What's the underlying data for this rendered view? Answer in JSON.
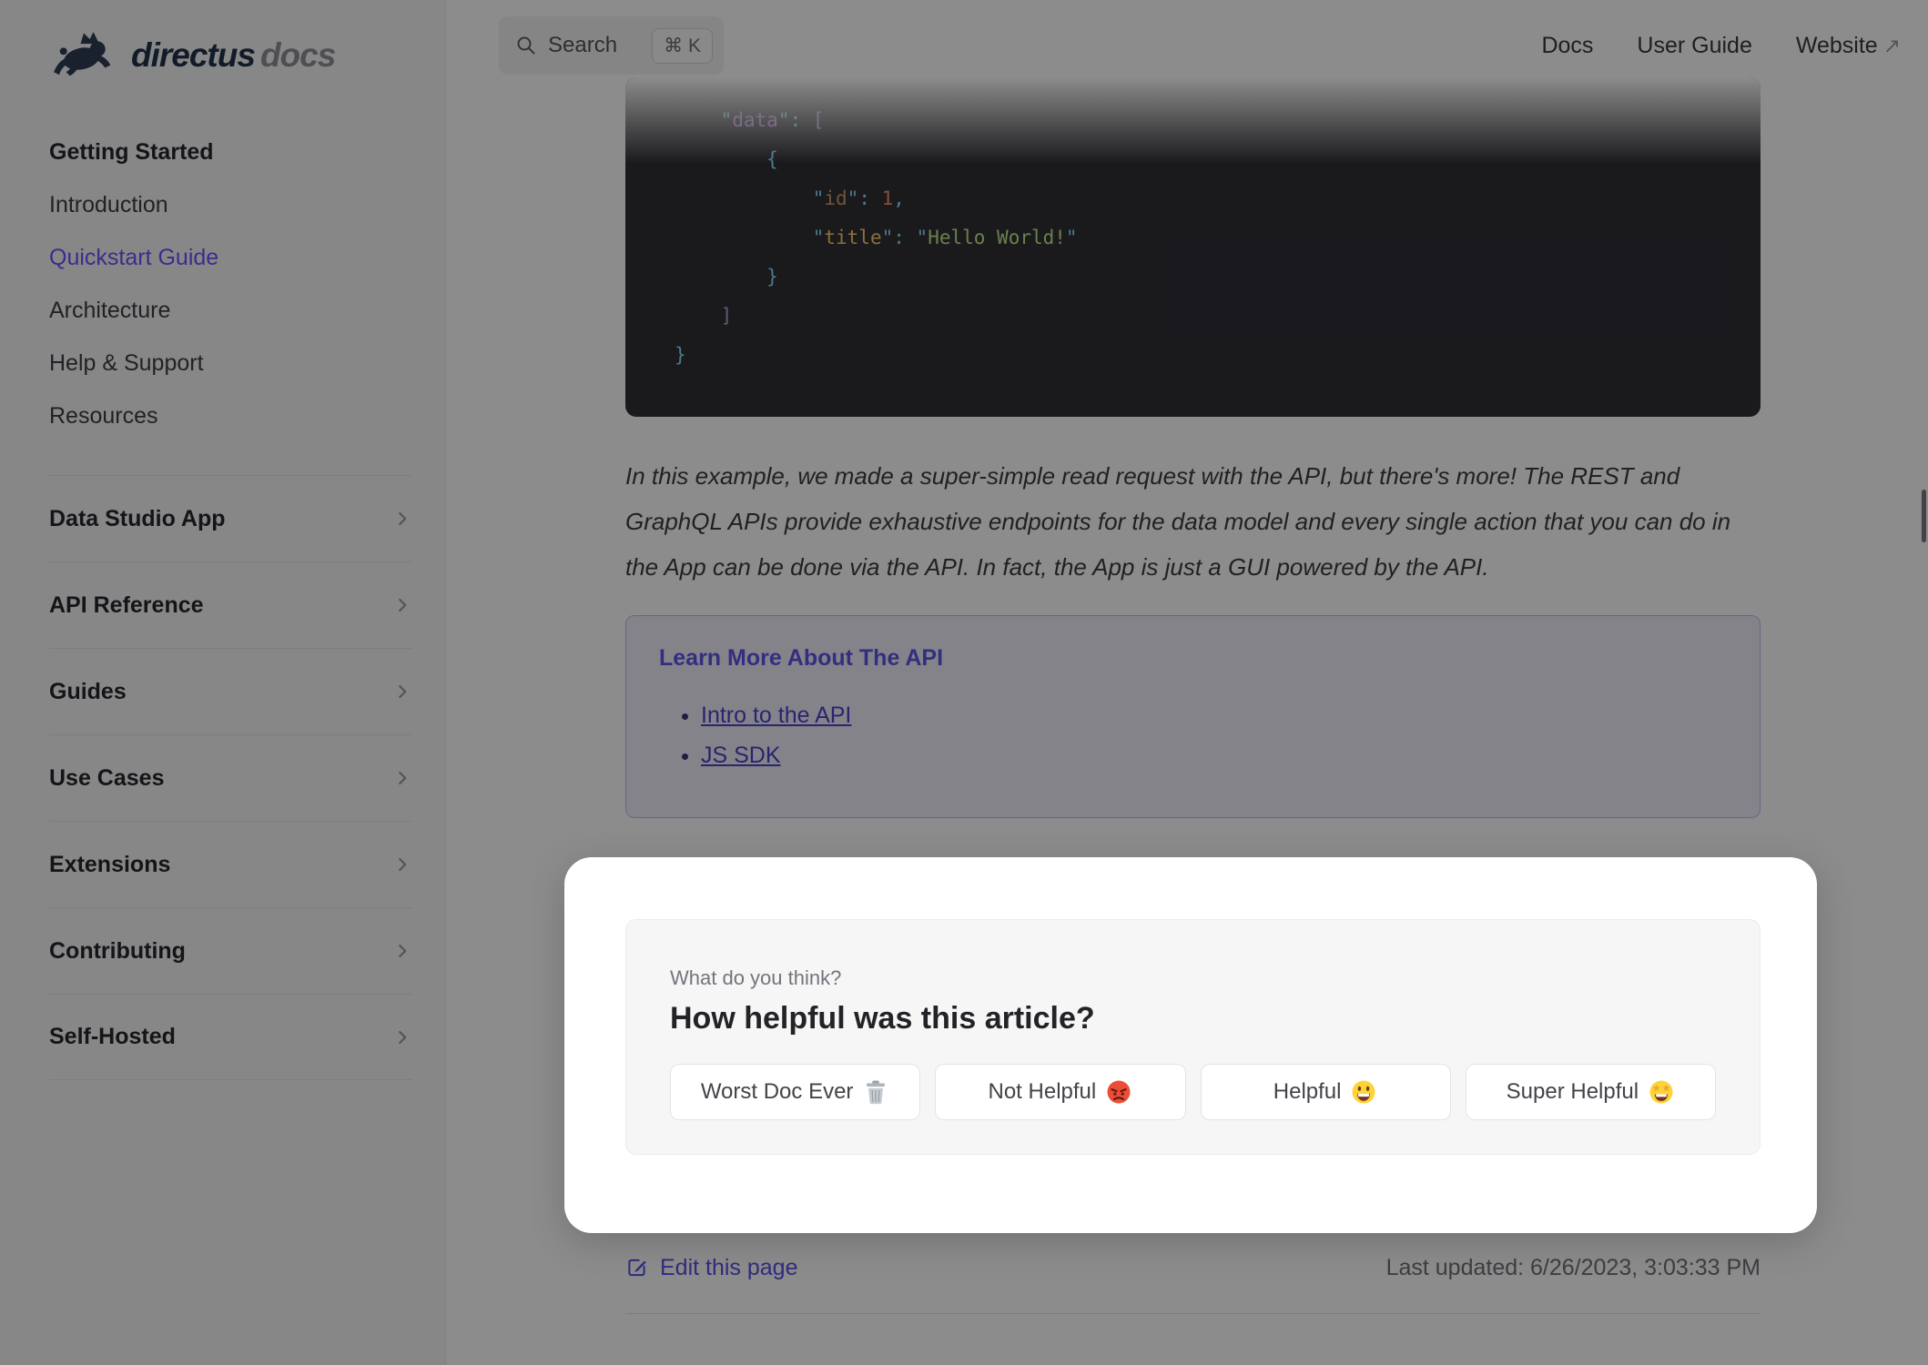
{
  "brand": {
    "name": "directus",
    "suffix": "docs",
    "logo_color": "#2e3d55"
  },
  "topnav": {
    "search_label": "Search",
    "search_shortcut": "⌘ K",
    "links": [
      {
        "label": "Docs"
      },
      {
        "label": "User Guide"
      },
      {
        "label": "Website",
        "external_arrow": "↗"
      }
    ]
  },
  "sidebar": {
    "section_title": "Getting Started",
    "items": [
      {
        "label": "Introduction",
        "active": false
      },
      {
        "label": "Quickstart Guide",
        "active": true
      },
      {
        "label": "Architecture",
        "active": false
      },
      {
        "label": "Help & Support",
        "active": false
      },
      {
        "label": "Resources",
        "active": false
      }
    ],
    "groups": [
      {
        "label": "Data Studio App"
      },
      {
        "label": "API Reference"
      },
      {
        "label": "Guides"
      },
      {
        "label": "Use Cases"
      },
      {
        "label": "Extensions"
      },
      {
        "label": "Contributing"
      },
      {
        "label": "Self-Hosted"
      }
    ]
  },
  "code": {
    "palette": {
      "fg": "#a6accd",
      "punct": "#89ddff",
      "bracket": "#a6accd",
      "key_purple": "#c792ea",
      "key_orange": "#d19a66",
      "key_yellow": "#ffcb6b",
      "num": "#f78c6c",
      "str": "#c3e88d"
    },
    "lines": [
      [
        {
          "t": "    ",
          "c": "fg"
        },
        {
          "t": "\"",
          "c": "punct"
        },
        {
          "t": "data",
          "c": "key_purple"
        },
        {
          "t": "\"",
          "c": "punct"
        },
        {
          "t": ": ",
          "c": "punct"
        },
        {
          "t": "[",
          "c": "bracket"
        }
      ],
      [
        {
          "t": "        ",
          "c": "fg"
        },
        {
          "t": "{",
          "c": "punct"
        }
      ],
      [
        {
          "t": "            ",
          "c": "fg"
        },
        {
          "t": "\"",
          "c": "punct"
        },
        {
          "t": "id",
          "c": "key_orange"
        },
        {
          "t": "\"",
          "c": "punct"
        },
        {
          "t": ": ",
          "c": "punct"
        },
        {
          "t": "1",
          "c": "num"
        },
        {
          "t": ",",
          "c": "punct"
        }
      ],
      [
        {
          "t": "            ",
          "c": "fg"
        },
        {
          "t": "\"",
          "c": "punct"
        },
        {
          "t": "title",
          "c": "key_yellow"
        },
        {
          "t": "\"",
          "c": "punct"
        },
        {
          "t": ": ",
          "c": "punct"
        },
        {
          "t": "\"",
          "c": "punct"
        },
        {
          "t": "Hello World!",
          "c": "str"
        },
        {
          "t": "\"",
          "c": "punct"
        }
      ],
      [
        {
          "t": "        ",
          "c": "fg"
        },
        {
          "t": "}",
          "c": "punct"
        }
      ],
      [
        {
          "t": "    ",
          "c": "fg"
        },
        {
          "t": "]",
          "c": "bracket"
        }
      ],
      [
        {
          "t": "}",
          "c": "punct"
        }
      ]
    ]
  },
  "content": {
    "paragraph": "In this example, we made a super-simple read request with the API, but there's more! The REST and GraphQL APIs provide exhaustive endpoints for the data model and every single action that you can do in the App can be done via the API. In fact, the App is just a GUI powered by the API."
  },
  "learn_more": {
    "title": "Learn More About The API",
    "links": [
      "Intro to the API",
      "JS SDK"
    ]
  },
  "feedback": {
    "kicker": "What do you think?",
    "question": "How helpful was this article?",
    "options": [
      {
        "label": "Worst Doc Ever",
        "emoji": "wastebasket"
      },
      {
        "label": "Not Helpful",
        "emoji": "angry-face"
      },
      {
        "label": "Helpful",
        "emoji": "smiling-face"
      },
      {
        "label": "Super Helpful",
        "emoji": "star-struck-face"
      }
    ]
  },
  "footer": {
    "edit_label": "Edit this page",
    "last_updated": "Last updated: 6/26/2023, 3:03:33 PM"
  },
  "colors": {
    "brand_purple": "#6a52ff",
    "dim_overlay": "rgba(0,0,0,0.45)",
    "sidebar_bg": "#f6f6f7",
    "code_bg": "#303036",
    "learn_box_bg": "#f0effc",
    "learn_box_border": "#bfb9f2"
  }
}
